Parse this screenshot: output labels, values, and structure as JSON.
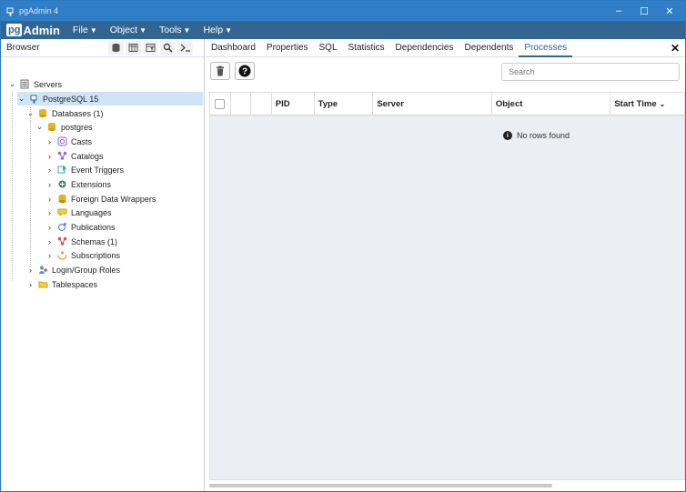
{
  "window": {
    "title": "pgAdmin 4"
  },
  "menubar": {
    "logo_pg": "pg",
    "logo_admin": "Admin",
    "items": [
      {
        "label": "File",
        "icon": "chevron-down-icon"
      },
      {
        "label": "Object",
        "icon": "chevron-down-icon"
      },
      {
        "label": "Tools",
        "icon": "chevron-down-icon"
      },
      {
        "label": "Help",
        "icon": "chevron-down-icon"
      }
    ]
  },
  "browser": {
    "label": "Browser",
    "tools": [
      "database-icon",
      "table-icon",
      "filter-table-icon",
      "search-icon",
      "terminal-icon"
    ],
    "tree": {
      "servers": "Servers",
      "server": "PostgreSQL 15",
      "databases": "Databases (1)",
      "db": "postgres",
      "children": [
        "Casts",
        "Catalogs",
        "Event Triggers",
        "Extensions",
        "Foreign Data Wrappers",
        "Languages",
        "Publications",
        "Schemas (1)",
        "Subscriptions"
      ],
      "login_roles": "Login/Group Roles",
      "tablespaces": "Tablespaces"
    }
  },
  "tabs": [
    "Dashboard",
    "Properties",
    "SQL",
    "Statistics",
    "Dependencies",
    "Dependents",
    "Processes"
  ],
  "active_tab": "Processes",
  "toolbar": {
    "search_placeholder": "Search"
  },
  "grid": {
    "columns": [
      "PID",
      "Type",
      "Server",
      "Object",
      "Start Time"
    ],
    "empty_message": "No rows found"
  },
  "colors": {
    "titlebar": "#2f7ec6",
    "menubar": "#326690",
    "selected": "#cfe4f7"
  }
}
